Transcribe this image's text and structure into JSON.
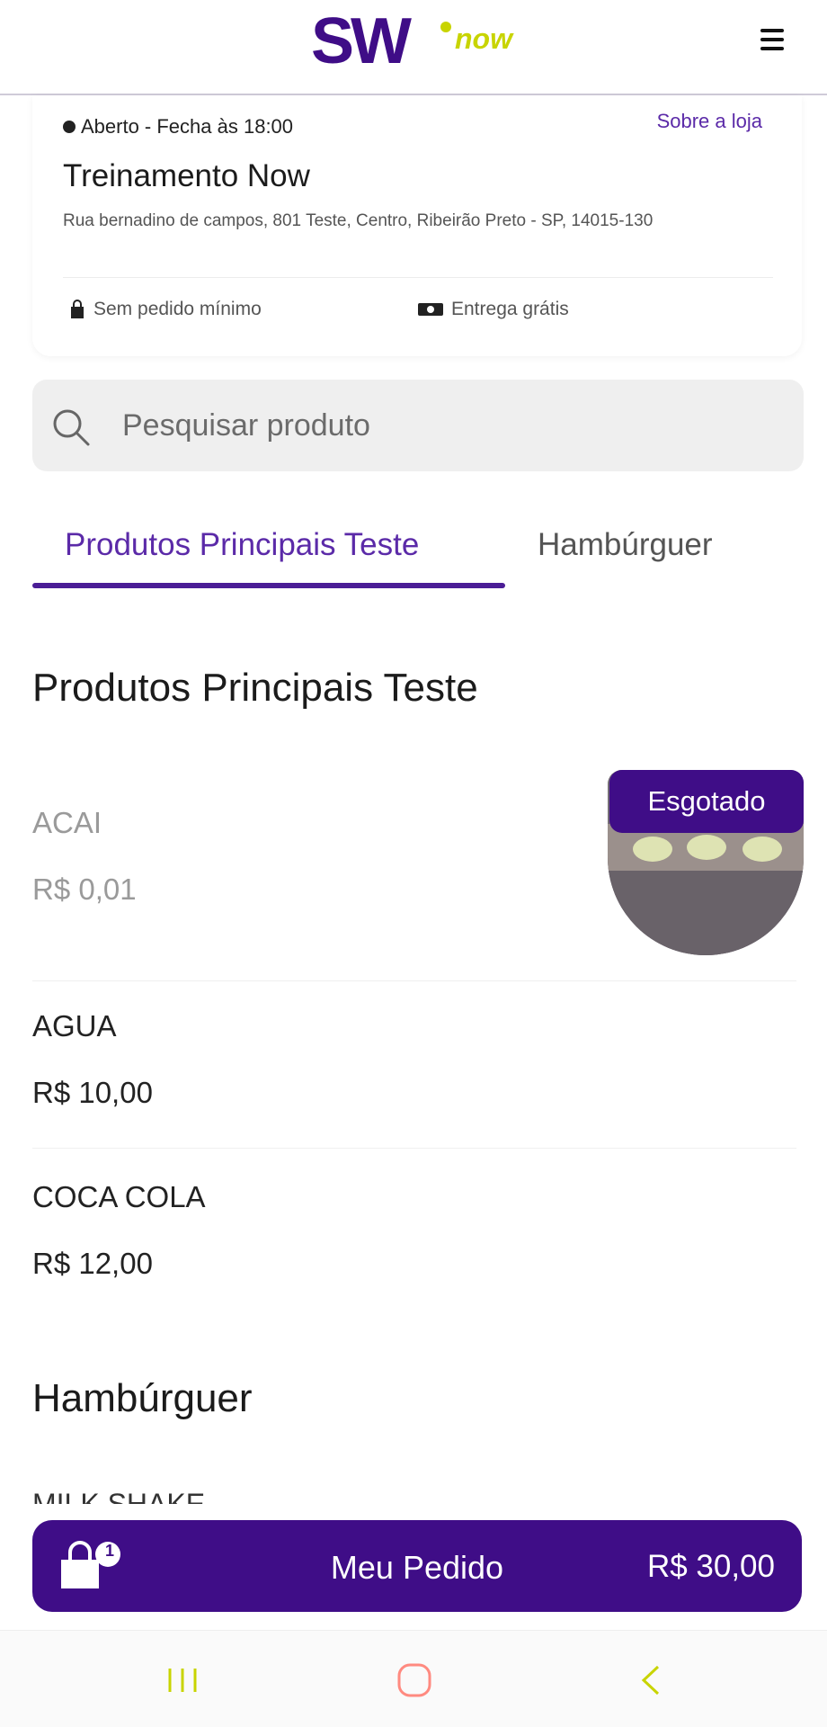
{
  "header": {
    "logo_text": "SW now",
    "colors": {
      "brand_purple": "#3f0d87",
      "brand_lime": "#c8d400"
    }
  },
  "store": {
    "status": "Aberto - Fecha às 18:00",
    "about_link": "Sobre a loja",
    "name": "Treinamento Now",
    "address": "Rua bernadino de campos, 801 Teste, Centro, Ribeirão Preto - SP, 14015-130",
    "min_order": "Sem pedido mínimo",
    "delivery": "Entrega grátis"
  },
  "search": {
    "placeholder": "Pesquisar produto"
  },
  "tabs": [
    {
      "label": "Produtos Principais Teste",
      "active": true
    },
    {
      "label": "Hambúrguer",
      "active": false
    }
  ],
  "sections": [
    {
      "title": "Produtos Principais Teste",
      "products": [
        {
          "name": "ACAI",
          "price": "R$ 0,01",
          "badge": "Esgotado"
        },
        {
          "name": "AGUA",
          "price": "R$ 10,00"
        },
        {
          "name": "COCA COLA",
          "price": "R$ 12,00"
        }
      ]
    },
    {
      "title": "Hambúrguer",
      "products": [
        {
          "name": "MILK SHAKE"
        }
      ]
    }
  ],
  "order_bar": {
    "label": "Meu Pedido",
    "total": "R$ 30,00",
    "item_count": "1"
  },
  "nav": {
    "icons": [
      "recent-apps-icon",
      "home-icon",
      "back-icon"
    ]
  }
}
